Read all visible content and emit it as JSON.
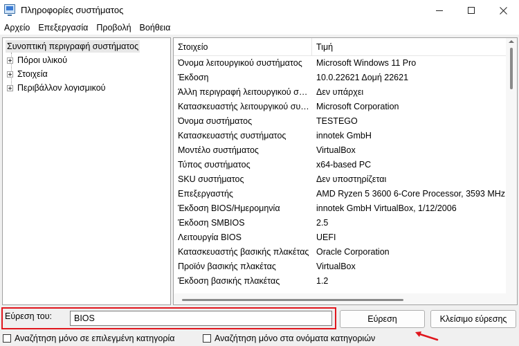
{
  "window": {
    "title": "Πληροφορίες συστήματος"
  },
  "menu": [
    "Αρχείο",
    "Επεξεργασία",
    "Προβολή",
    "Βοήθεια"
  ],
  "tree": {
    "root": "Συνοπτική περιγραφή συστήματος",
    "children": [
      "Πόροι υλικού",
      "Στοιχεία",
      "Περιβάλλον λογισμικού"
    ]
  },
  "table": {
    "headers": {
      "item": "Στοιχείο",
      "value": "Τιμή"
    },
    "rows": [
      {
        "item": "Όνομα λειτουργικού συστήματος",
        "value": "Microsoft Windows 11 Pro"
      },
      {
        "item": "Έκδοση",
        "value": "10.0.22621 Δομή 22621"
      },
      {
        "item": "Άλλη περιγραφή λειτουργικού συστήματος",
        "value": "Δεν υπάρχει"
      },
      {
        "item": "Κατασκευαστής λειτουργικού συστήματος",
        "value": "Microsoft Corporation"
      },
      {
        "item": "Όνομα συστήματος",
        "value": "TESTEGO"
      },
      {
        "item": "Κατασκευαστής συστήματος",
        "value": "innotek GmbH"
      },
      {
        "item": "Μοντέλο συστήματος",
        "value": "VirtualBox"
      },
      {
        "item": "Τύπος συστήματος",
        "value": "x64-based PC"
      },
      {
        "item": "SKU συστήματος",
        "value": "Δεν υποστηρίζεται"
      },
      {
        "item": "Επεξεργαστής",
        "value": "AMD Ryzen 5 3600 6-Core Processor, 3593 MHz"
      },
      {
        "item": "Έκδοση BIOS/Ημερομηνία",
        "value": "innotek GmbH VirtualBox, 1/12/2006"
      },
      {
        "item": "Έκδοση SMBIOS",
        "value": "2.5"
      },
      {
        "item": "Λειτουργία BIOS",
        "value": "UEFI"
      },
      {
        "item": "Κατασκευαστής βασικής πλακέτας",
        "value": "Oracle Corporation"
      },
      {
        "item": "Προϊόν βασικής πλακέτας",
        "value": "VirtualBox"
      },
      {
        "item": "Έκδοση βασικής πλακέτας",
        "value": "1.2"
      }
    ]
  },
  "find": {
    "label": "Εύρεση του:",
    "value": "BIOS",
    "find_button": "Εύρεση",
    "close_button": "Κλείσιμο εύρεσης",
    "check_selected_category": "Αναζήτηση μόνο σε επιλεγμένη κατηγορία",
    "check_category_names": "Αναζήτηση μόνο στα ονόματα κατηγοριών"
  },
  "colors": {
    "highlight": "#e0161d",
    "accent": "#3a7bd5"
  }
}
